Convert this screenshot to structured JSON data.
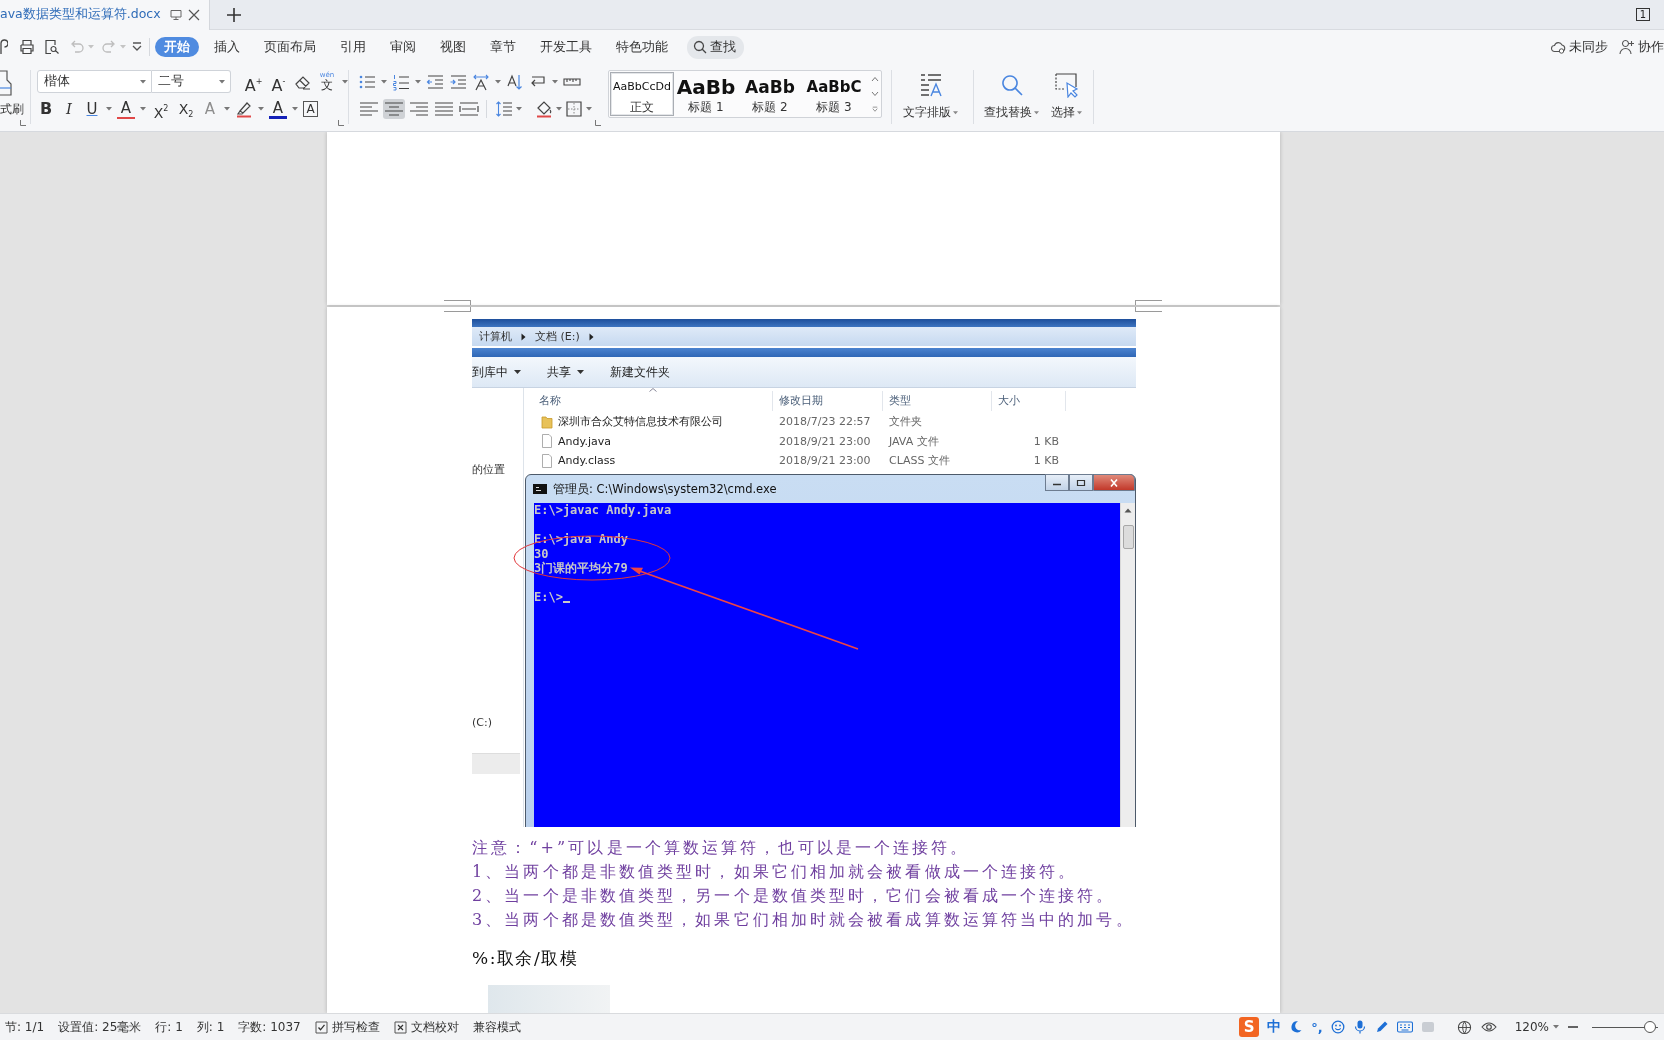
{
  "tab_bar": {
    "document_tab": "ava数据类型和运算符.docx",
    "window_badge": "1"
  },
  "quick_access": {
    "undo": {
      "disabled": true
    },
    "redo": {
      "disabled": true
    }
  },
  "menu_tabs": [
    {
      "label": "开始",
      "selected": true
    },
    {
      "label": "插入",
      "selected": false
    },
    {
      "label": "页面布局",
      "selected": false
    },
    {
      "label": "引用",
      "selected": false
    },
    {
      "label": "审阅",
      "selected": false
    },
    {
      "label": "视图",
      "selected": false
    },
    {
      "label": "章节",
      "selected": false
    },
    {
      "label": "开发工具",
      "selected": false
    },
    {
      "label": "特色功能",
      "selected": false
    }
  ],
  "search": {
    "label": "查找"
  },
  "account": {
    "sync": "未同步",
    "collab": "协作"
  },
  "ribbon": {
    "format_painter": "式刷",
    "font_name": "楷体",
    "font_size": "二号",
    "grow_font": "A$^{+}$",
    "shrink_font": "A$^{-}$",
    "phonetic": {
      "top": "wén",
      "bottom": "文"
    },
    "bold": "B",
    "italic": "I",
    "underline": "U",
    "strikethrough": "A",
    "superscript": "X$^{2}$",
    "subscript": "X$_{2}$",
    "text_effect": "A",
    "font_color": "A",
    "char_border": "A",
    "alignment": [
      {
        "selected": false
      },
      {
        "selected": true
      },
      {
        "selected": false
      },
      {
        "selected": false
      },
      {
        "selected": false
      }
    ],
    "styles": [
      {
        "sample": "AaBbCcDd",
        "label": "正文",
        "selected": true
      },
      {
        "sample": "AaBb",
        "label": "标题 1",
        "selected": false
      },
      {
        "sample": "AaBb",
        "label": "标题 2",
        "selected": false
      },
      {
        "sample": "AaBbC",
        "label": "标题 3",
        "selected": false
      }
    ],
    "big_buttons": [
      {
        "label": "文字排版"
      },
      {
        "label": "查找替换"
      },
      {
        "label": "选择"
      }
    ]
  },
  "document": {
    "screenshot": {
      "breadcrumb": [
        "计算机",
        "文档 (E:)"
      ],
      "toolbar": [
        {
          "label": "到库中",
          "dropdown": true
        },
        {
          "label": "共享",
          "dropdown": true
        },
        {
          "label": "新建文件夹",
          "dropdown": false
        }
      ],
      "nav": [
        "的位置",
        "(C:)"
      ],
      "columns": [
        "名称",
        "修改日期",
        "类型",
        "大小"
      ],
      "files": [
        {
          "kind": "folder",
          "name": "深圳市合众艾特信息技术有限公司",
          "date": "2018/7/23 22:57",
          "type": "文件夹"
        },
        {
          "kind": "file",
          "name": "Andy.java",
          "date": "2018/9/21 23:00",
          "type": "JAVA 文件",
          "size": "1 KB"
        },
        {
          "kind": "file",
          "name": "Andy.class",
          "date": "2018/9/21 23:00",
          "type": "CLASS 文件",
          "size": "1 KB"
        }
      ],
      "console": {
        "title": "管理员: C:\\Windows\\system32\\cmd.exe",
        "blocks": [
          [
            "E:\\>javac Andy.java"
          ],
          [
            "E:\\>java Andy",
            "30",
            "3门课的平均分79"
          ],
          [
            "E:\\>"
          ]
        ]
      }
    },
    "notes": [
      "注意：“+”可以是一个算数运算符，也可以是一个连接符。",
      "1、当两个都是非数值类型时，如果它们相加就会被看做成一个连接符。",
      "2、当一个是非数值类型，另一个是数值类型时，它们会被看成一个连接符。",
      "3、当两个都是数值类型，如果它们相加时就会被看成算数运算符当中的加号。"
    ],
    "heading": "%:取余/取模"
  },
  "status_bar": {
    "items": [
      "节: 1/1",
      "设置值: 25毫米",
      "行: 1",
      "列: 1",
      "字数: 1037"
    ],
    "spell_check": "拼写检查",
    "proofread": "文档校对",
    "compat_mode": "兼容模式",
    "ime": {
      "logo": "S",
      "lang": "中",
      "punct": "°,"
    },
    "zoom": "120%",
    "zoom_slider": {
      "level": 0.88
    }
  }
}
